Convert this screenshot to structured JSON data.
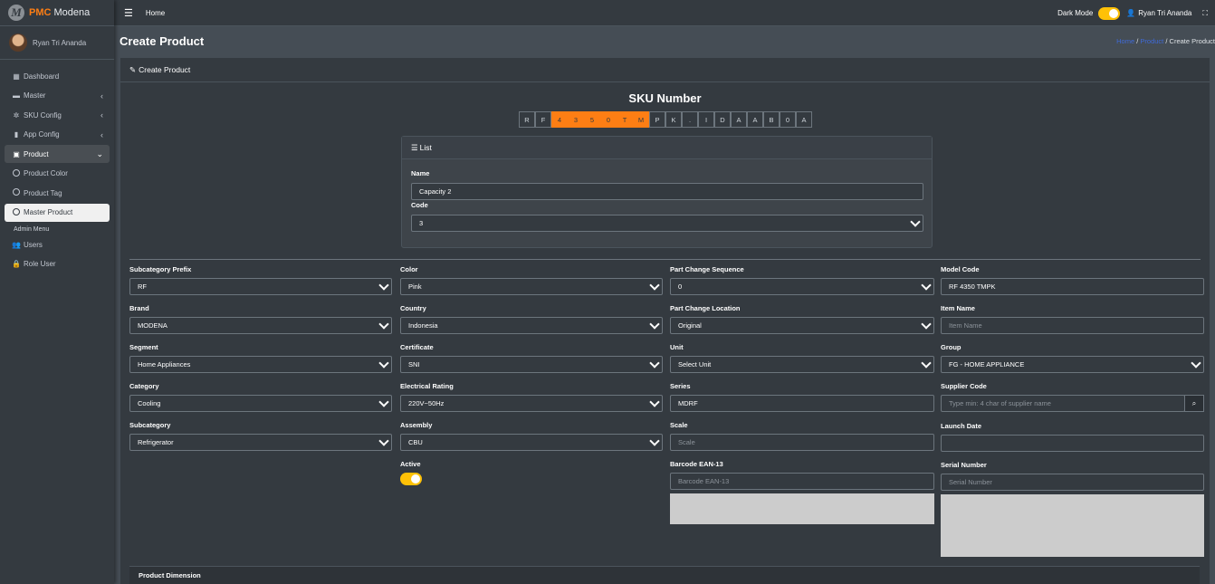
{
  "brand": {
    "accent": "PMC",
    "name": " Modena",
    "logo_letter": "M"
  },
  "user": {
    "name": "Ryan Tri Ananda"
  },
  "sidebar": {
    "items": [
      {
        "label": "Dashboard",
        "icon": "grid-icon"
      },
      {
        "label": "Master",
        "icon": "car-icon"
      },
      {
        "label": "SKU Config",
        "icon": "gear-icon"
      },
      {
        "label": "App Config",
        "icon": "mobile-icon"
      },
      {
        "label": "Product",
        "icon": "box-icon"
      },
      {
        "label": "Product Color",
        "icon": "circle-icon"
      },
      {
        "label": "Product Tag",
        "icon": "circle-icon"
      },
      {
        "label": "Master Product",
        "icon": "circle-icon"
      }
    ],
    "admin_header": "Admin Menu",
    "admin_items": [
      {
        "label": "Users",
        "icon": "users-icon"
      },
      {
        "label": "Role User",
        "icon": "lock-icon"
      }
    ]
  },
  "topbar": {
    "home": "Home",
    "dark_mode": "Dark Mode",
    "user": "Ryan Tri Ananda"
  },
  "header": {
    "title": "Create Product",
    "breadcrumb": [
      "Home",
      "Product",
      "Create Product"
    ]
  },
  "card": {
    "title": "Create Product"
  },
  "sku": {
    "title": "SKU Number",
    "chars": [
      "R",
      "F",
      "4",
      "3",
      "5",
      "0",
      "T",
      "M",
      "P",
      "K",
      ".",
      "I",
      "D",
      "A",
      "A",
      "B",
      "0",
      "A"
    ],
    "highlight_indices": [
      2,
      3,
      4,
      5,
      6,
      7
    ]
  },
  "list": {
    "title": "List",
    "name_label": "Name",
    "name_value": "Capacity 2",
    "code_label": "Code",
    "code_value": "3"
  },
  "form": {
    "subcategory_prefix": {
      "label": "Subcategory Prefix",
      "value": "RF"
    },
    "brand": {
      "label": "Brand",
      "value": "MODENA"
    },
    "segment": {
      "label": "Segment",
      "value": "Home Appliances"
    },
    "category": {
      "label": "Category",
      "value": "Cooling"
    },
    "subcategory": {
      "label": "Subcategory",
      "value": "Refrigerator"
    },
    "color": {
      "label": "Color",
      "value": "Pink"
    },
    "country": {
      "label": "Country",
      "value": "Indonesia"
    },
    "certificate": {
      "label": "Certificate",
      "value": "SNI"
    },
    "electrical_rating": {
      "label": "Electrical Rating",
      "value": "220V~50Hz"
    },
    "assembly": {
      "label": "Assembly",
      "value": "CBU"
    },
    "active": {
      "label": "Active"
    },
    "part_change_sequence": {
      "label": "Part Change Sequence",
      "value": "0"
    },
    "part_change_location": {
      "label": "Part Change Location",
      "value": "Original"
    },
    "unit": {
      "label": "Unit",
      "value": "Select Unit"
    },
    "series": {
      "label": "Series",
      "value": "MDRF"
    },
    "scale": {
      "label": "Scale",
      "placeholder": "Scale"
    },
    "barcode": {
      "label": "Barcode EAN-13",
      "placeholder": "Barcode EAN-13"
    },
    "model_code": {
      "label": "Model Code",
      "value": "RF 4350 TMPK"
    },
    "item_name": {
      "label": "Item Name",
      "placeholder": "Item Name"
    },
    "group": {
      "label": "Group",
      "value": "FG - HOME APPLIANCE"
    },
    "supplier_code": {
      "label": "Supplier Code",
      "placeholder": "Type min: 4 char of supplier name"
    },
    "launch_date": {
      "label": "Launch Date",
      "value": ""
    },
    "serial_number": {
      "label": "Serial Number",
      "placeholder": "Serial Number"
    }
  },
  "dimension": {
    "title": "Product Dimension"
  },
  "colors": {
    "accent": "#fd7e14",
    "toggle": "#ffc107",
    "link": "#3f6ad8"
  }
}
